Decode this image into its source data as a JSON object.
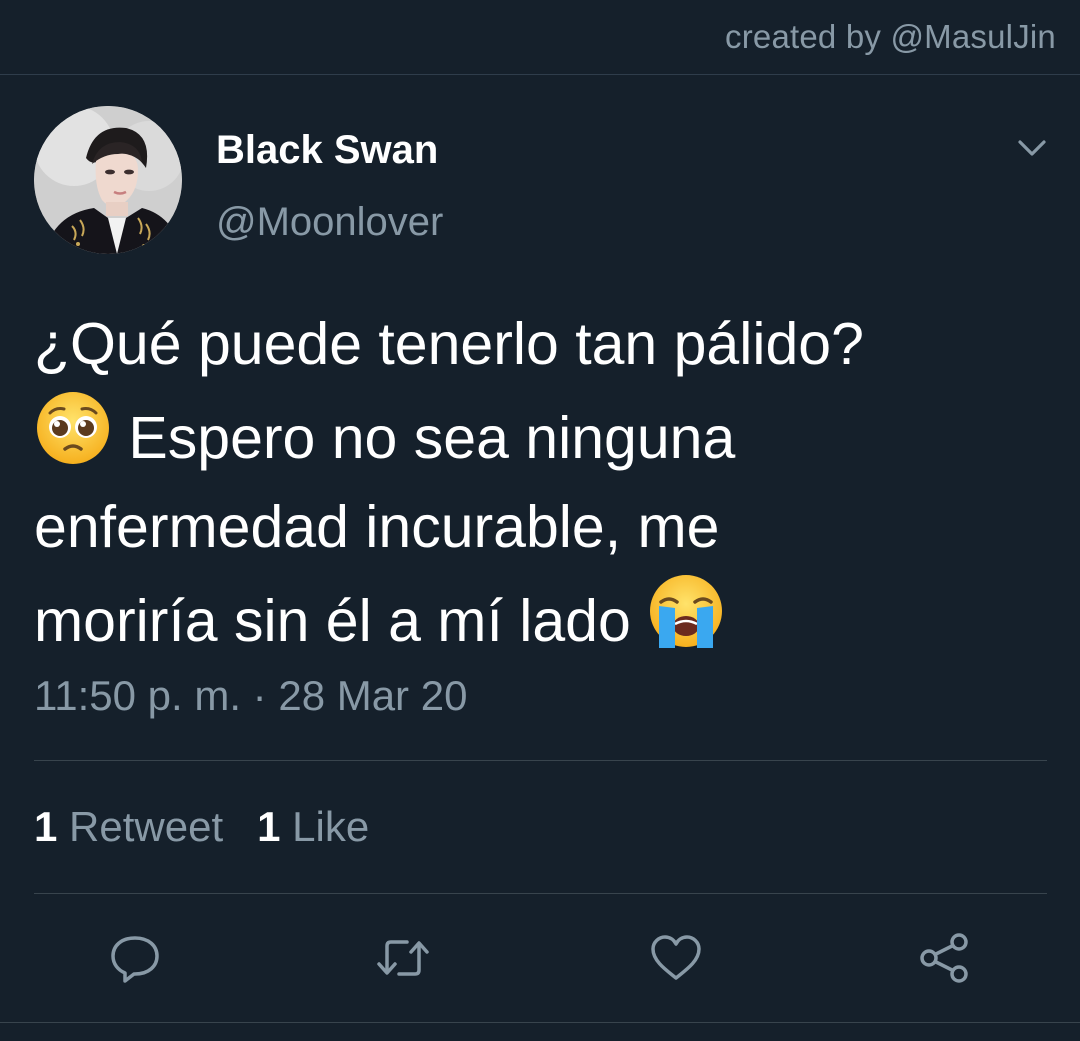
{
  "credit": "created by @MasulJin",
  "author": {
    "display_name": "Black Swan",
    "handle": "@Moonlover"
  },
  "tweet": {
    "line1": "¿Qué puede tenerlo tan pálido?",
    "line2_emoji": "pleading-face",
    "line2": "Espero no sea ninguna",
    "line3": "enfermedad incurable, me",
    "line4": "moriría sin él a mí lado",
    "line4_emoji": "loudly-crying-face"
  },
  "timestamp": "11:50 p. m. · 28 Mar 20",
  "stats": {
    "retweet_count": "1",
    "retweet_label": "Retweet",
    "like_count": "1",
    "like_label": "Like"
  },
  "actions": [
    "reply-icon",
    "retweet-icon",
    "like-icon",
    "share-icon"
  ],
  "colors": {
    "background": "#15202b",
    "secondary_text": "#8899a6",
    "divider": "#38444d",
    "primary_text": "#ffffff"
  }
}
